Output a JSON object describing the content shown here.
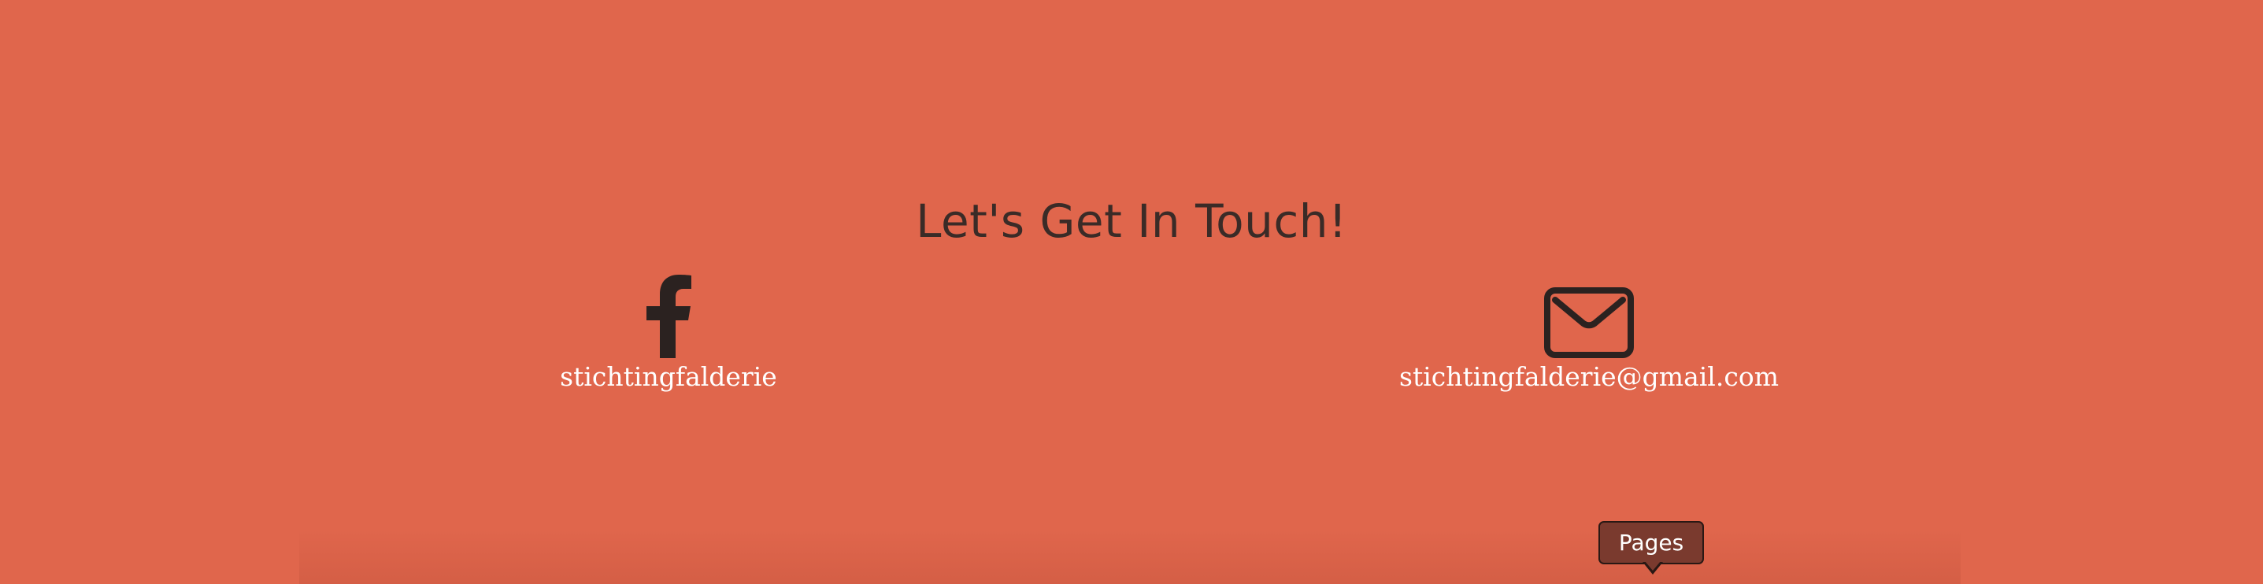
{
  "section": {
    "heading": "Let's Get In Touch!"
  },
  "contacts": {
    "facebook": {
      "icon": "facebook-icon",
      "label": "stichtingfalderie"
    },
    "email": {
      "icon": "envelope-icon",
      "label": "stichtingfalderie@gmail.com"
    }
  },
  "tooltip": {
    "label": "Pages"
  },
  "colors": {
    "background": "#e0664c",
    "heading": "#3a2b27",
    "icon": "#2b2220",
    "label": "#ffffff",
    "tooltip_bg": "#7a3a2e"
  }
}
